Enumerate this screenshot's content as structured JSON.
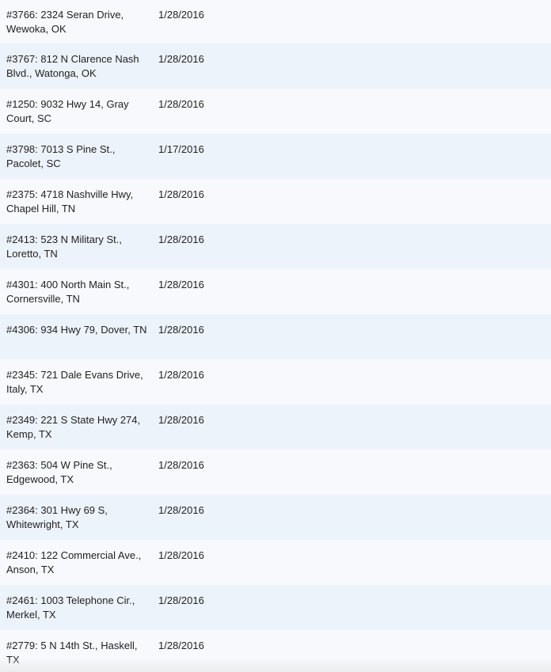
{
  "rows": [
    {
      "address": "#3766: 2324 Seran Drive, Wewoka, OK",
      "date": "1/28/2016"
    },
    {
      "address": "#3767: 812 N Clarence Nash Blvd., Watonga, OK",
      "date": "1/28/2016"
    },
    {
      "address": "#1250: 9032 Hwy 14, Gray Court, SC",
      "date": "1/28/2016"
    },
    {
      "address": "#3798: 7013 S Pine St., Pacolet, SC",
      "date": "1/17/2016"
    },
    {
      "address": "#2375: 4718 Nashville Hwy, Chapel Hill, TN",
      "date": "1/28/2016"
    },
    {
      "address": "#2413: 523 N Military St., Loretto, TN",
      "date": "1/28/2016"
    },
    {
      "address": "#4301: 400 North Main St., Cornersville, TN",
      "date": "1/28/2016"
    },
    {
      "address": "#4306: 934 Hwy 79, Dover, TN",
      "date": "1/28/2016"
    },
    {
      "address": "#2345: 721 Dale Evans Drive, Italy, TX",
      "date": "1/28/2016"
    },
    {
      "address": "#2349: 221 S State Hwy 274, Kemp, TX",
      "date": "1/28/2016"
    },
    {
      "address": "#2363: 504 W Pine St., Edgewood, TX",
      "date": "1/28/2016"
    },
    {
      "address": "#2364: 301 Hwy 69 S, Whitewright, TX",
      "date": "1/28/2016"
    },
    {
      "address": "#2410: 122 Commercial Ave., Anson, TX",
      "date": "1/28/2016"
    },
    {
      "address": "#2461: 1003 Telephone Cir., Merkel, TX",
      "date": "1/28/2016"
    },
    {
      "address": "#2779: 5 N 14th St., Haskell, TX",
      "date": "1/28/2016"
    }
  ]
}
